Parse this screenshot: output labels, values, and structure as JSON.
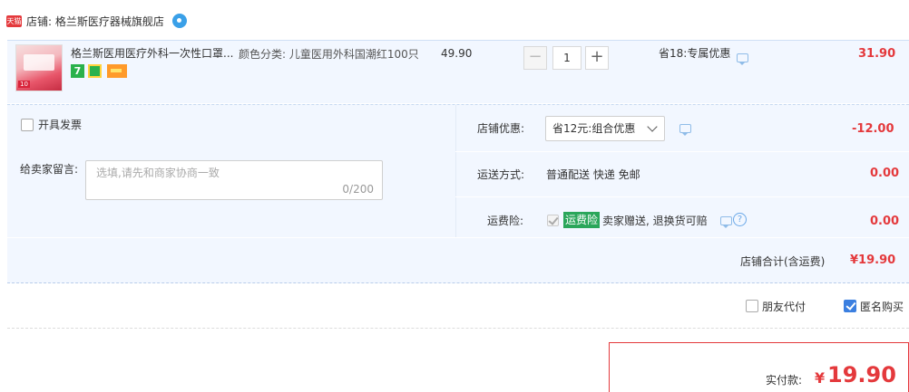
{
  "store": {
    "badge": "天猫",
    "name": "店铺: 格兰斯医疗器械旗舰店"
  },
  "item": {
    "thumb_tag": "10",
    "title": "格兰斯医用医疗外科一次性口罩...",
    "tag_seven": "7",
    "sku": "颜色分类: 儿童医用外科国潮红100只",
    "unit_price": "49.90",
    "quantity": "1",
    "qty_minus": "−",
    "qty_plus": "+",
    "promo": "省18:专属优惠",
    "total": "31.90"
  },
  "invoice": {
    "label": "开具发票"
  },
  "note": {
    "label": "给卖家留言:",
    "placeholder": "选填,请先和商家协商一致",
    "count": "0/200"
  },
  "shop_discount": {
    "label": "店铺优惠:",
    "selected": "省12元:组合优惠",
    "amount": "-12.00"
  },
  "shipping": {
    "label": "运送方式:",
    "value": "普通配送 快递 免邮",
    "amount": "0.00"
  },
  "insurance": {
    "label": "运费险:",
    "badge": "运费险",
    "text": "卖家赠送, 退换货可赔",
    "help": "?",
    "amount": "0.00"
  },
  "subtotal": {
    "label": "店铺合计(含运费)",
    "amount": "¥19.90"
  },
  "options": {
    "friend_pay": "朋友代付",
    "anonymous": "匿名购买"
  },
  "payment": {
    "label": "实付款:",
    "currency": "¥",
    "amount": "19.90"
  },
  "colors": {
    "price_red": "#e4393c",
    "row_bg": "#f2f7ff",
    "check_blue": "#3b7fe0",
    "insurance_green": "#2aa65a"
  }
}
